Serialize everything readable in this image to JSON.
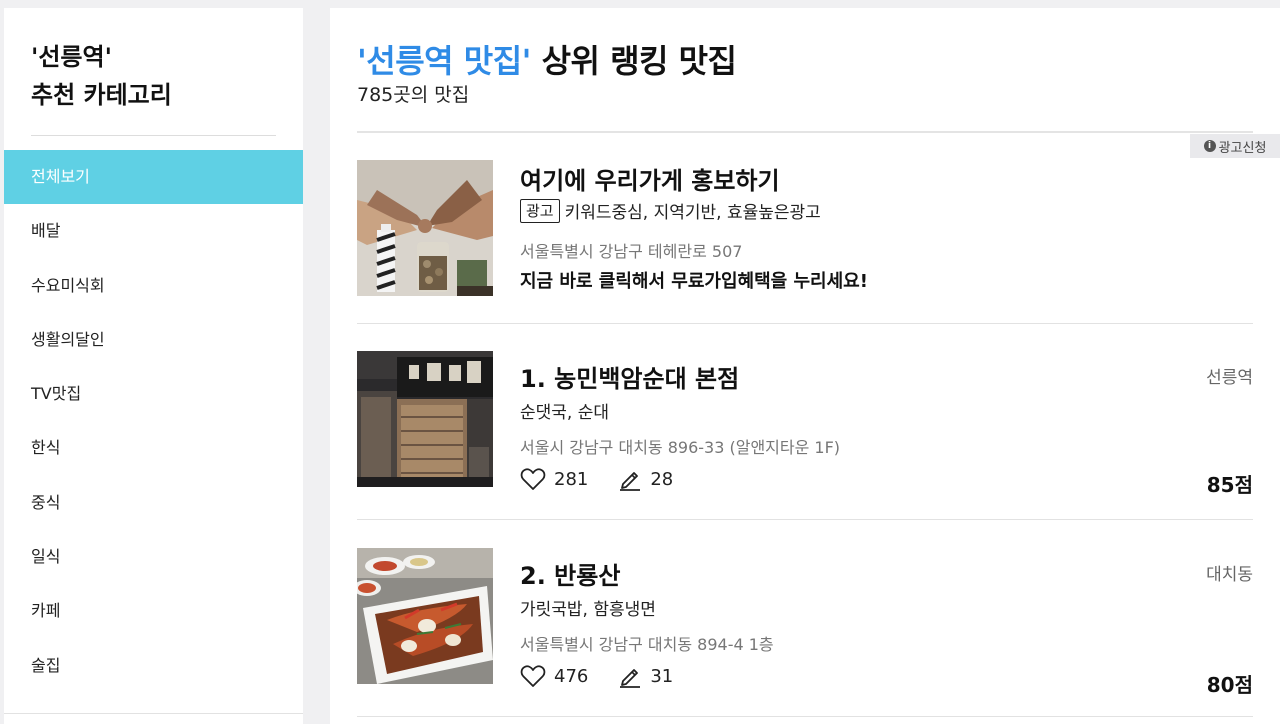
{
  "sidebar": {
    "title_line1": "'선릉역'",
    "title_line2": "추천 카테고리",
    "items": [
      {
        "label": "전체보기",
        "active": true
      },
      {
        "label": "배달"
      },
      {
        "label": "수요미식회"
      },
      {
        "label": "생활의달인"
      },
      {
        "label": "TV맛집"
      },
      {
        "label": "한식"
      },
      {
        "label": "중식"
      },
      {
        "label": "일식"
      },
      {
        "label": "카페"
      },
      {
        "label": "술집"
      }
    ]
  },
  "main": {
    "heading_highlight": "'선릉역 맛집'",
    "heading_rest": " 상위 랭킹 맛집",
    "count": "785곳의 맛집",
    "ad_apply_label": "광고신청",
    "ad": {
      "title": "여기에 우리가게 홍보하기",
      "badge": "광고",
      "keywords": "키워드중심, 지역기반, 효율높은광고",
      "address": "서울특별시 강남구 테헤란로 507",
      "cta": "지금 바로 클릭해서 무료가입혜택을 누리세요!"
    },
    "restaurants": [
      {
        "title": "1. 농민백암순대 본점",
        "category": "순댓국, 순대",
        "address": "서울시 강남구 대치동 896-33 (알앤지타운 1F)",
        "likes": "281",
        "reviews": "28",
        "region": "선릉역",
        "score": "85점"
      },
      {
        "title": "2. 반룡산",
        "category": "가릿국밥, 함흥냉면",
        "address": "서울특별시 강남구 대치동 894-4 1층",
        "likes": "476",
        "reviews": "31",
        "region": "대치동",
        "score": "80점"
      }
    ]
  },
  "icons": {
    "like": "heart-outline-icon",
    "review": "pencil-icon",
    "info": "info-icon"
  },
  "colors": {
    "accent": "#5fd0e4",
    "highlight": "#2f8be6"
  }
}
